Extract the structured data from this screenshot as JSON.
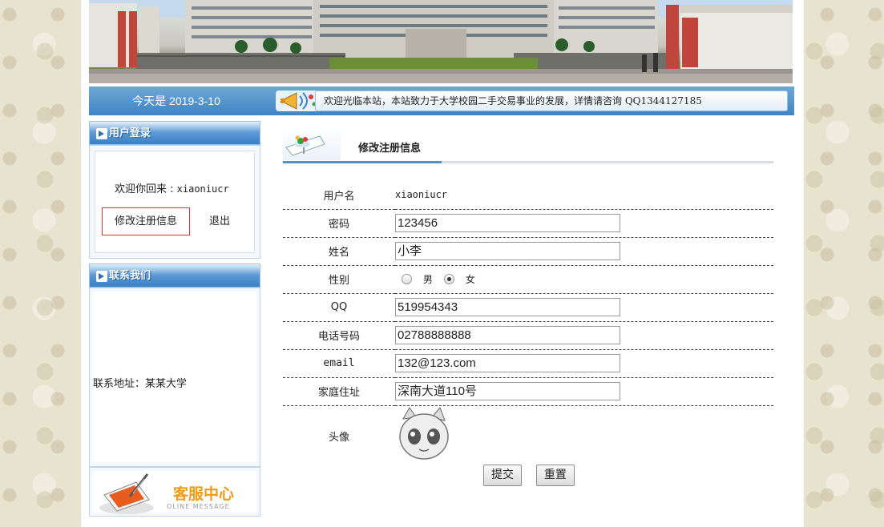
{
  "header": {
    "date_text": "今天是 2019-3-10",
    "notice": "欢迎光临本站，本站致力于大学校园二手交易事业的发展，详情请咨询 QQ1344127185"
  },
  "sidebar": {
    "login_title": "用户登录",
    "welcome_prefix": "欢迎你回来 : ",
    "username": "xiaoniucr",
    "edit_profile_label": "修改注册信息",
    "logout_label": "退出",
    "contact_title": "联系我们",
    "contact_address": "联系地址：某某大学",
    "service_title": "客服中心",
    "service_subtitle": "OLINE MESSAGE"
  },
  "main": {
    "title": "修改注册信息",
    "fields": {
      "username_label": "用户名",
      "username_value": "xiaoniucr",
      "password_label": "密码",
      "password_value": "123456",
      "name_label": "姓名",
      "name_value": "小李",
      "gender_label": "性别",
      "gender_options": [
        "男",
        "女"
      ],
      "gender_selected": "女",
      "qq_label": "QQ",
      "qq_value": "519954343",
      "phone_label": "电话号码",
      "phone_value": "02788888888",
      "email_label": "email",
      "email_value": "132@123.com",
      "address_label": "家庭住址",
      "address_value": "深南大道110号",
      "avatar_label": "头像"
    },
    "submit_label": "提交",
    "reset_label": "重置"
  },
  "colors": {
    "accent_blue": "#3f84c4",
    "service_orange": "#f39a12",
    "edit_border": "#dd3333"
  }
}
